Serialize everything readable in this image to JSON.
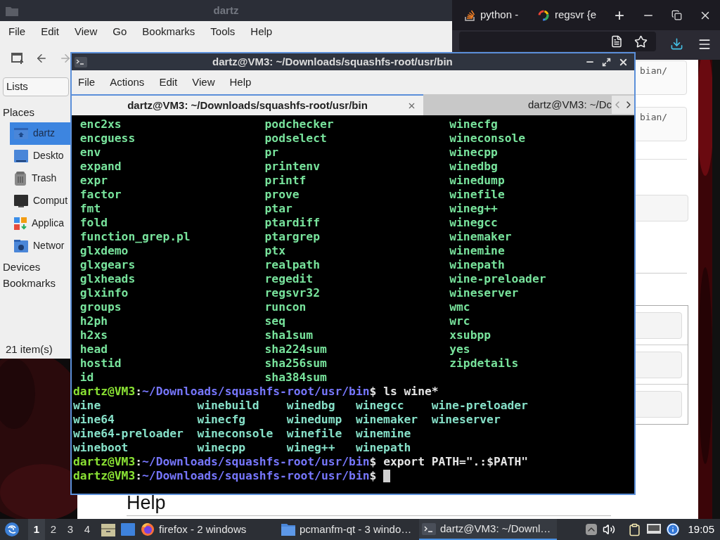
{
  "file_manager": {
    "title": "dartz",
    "menu": [
      "File",
      "Edit",
      "View",
      "Go",
      "Bookmarks",
      "Tools",
      "Help"
    ],
    "view_selector": "Lists",
    "places_heading": "Places",
    "places": [
      {
        "label": "dartz",
        "kind": "home",
        "selected": true
      },
      {
        "label": "Deskto",
        "kind": "desktop",
        "selected": false
      },
      {
        "label": "Trash",
        "kind": "trash",
        "selected": false
      },
      {
        "label": "Comput",
        "kind": "computer",
        "selected": false
      },
      {
        "label": "Applica",
        "kind": "apps",
        "selected": false
      },
      {
        "label": "Networ",
        "kind": "network",
        "selected": false
      }
    ],
    "sections": [
      "Devices",
      "Bookmarks"
    ],
    "status": "21 item(s)"
  },
  "browser": {
    "tabs": [
      {
        "label": "python -",
        "kind": "stack"
      },
      {
        "label": "regsvr {e",
        "kind": "google"
      }
    ],
    "new_tab": "+",
    "snippets": [
      "bian/",
      "bian/"
    ],
    "heading": "Help"
  },
  "terminal": {
    "title": "dartz@VM3: ~/Downloads/squashfs-root/usr/bin",
    "menu": [
      "File",
      "Actions",
      "Edit",
      "View",
      "Help"
    ],
    "tabs": [
      {
        "label": "dartz@VM3: ~/Downloads/squashfs-root/usr/bin",
        "selected": true
      },
      {
        "label": "dartz@VM3: ~/Dc",
        "selected": false
      }
    ],
    "output": [
      {
        "kind": "wide_listing",
        "columns": [
          [
            "enc2xs",
            "encguess",
            "env",
            "expand",
            "expr",
            "factor",
            "fmt",
            "fold",
            "function_grep.pl",
            "glxdemo",
            "glxgears",
            "glxheads",
            "glxinfo",
            "groups",
            "h2ph",
            "h2xs",
            "head",
            "hostid",
            "id"
          ],
          [
            "podchecker",
            "podselect",
            "pr",
            "printenv",
            "printf",
            "prove",
            "ptar",
            "ptardiff",
            "ptargrep",
            "ptx",
            "realpath",
            "regedit",
            "regsvr32",
            "runcon",
            "seq",
            "sha1sum",
            "sha224sum",
            "sha256sum",
            "sha384sum"
          ],
          [
            "winecfg",
            "wineconsole",
            "winecpp",
            "winedbg",
            "winedump",
            "winefile",
            "wineg++",
            "winegcc",
            "winemaker",
            "winemine",
            "winepath",
            "wine-preloader",
            "wineserver",
            "wmc",
            "wrc",
            "xsubpp",
            "yes",
            "zipdetails"
          ]
        ]
      },
      {
        "kind": "prompt",
        "cursor": false,
        "parts": [
          {
            "text": "dartz@VM3",
            "kind": "user"
          },
          {
            "text": ":",
            "kind": "plain"
          },
          {
            "text": "~/Downloads/squashfs-root/usr/bin",
            "kind": "path"
          },
          {
            "text": "$ ls wine*",
            "kind": "plain"
          }
        ]
      },
      {
        "kind": "listing",
        "columns": [
          [
            "wine",
            "wine64",
            "wine64-preloader",
            "wineboot"
          ],
          [
            "winebuild",
            "winecfg",
            "wineconsole",
            "winecpp"
          ],
          [
            "winedbg",
            "winedump",
            "winefile",
            "wineg++"
          ],
          [
            "winegcc",
            "winemaker",
            "winemine",
            "winepath"
          ],
          [
            "wine-preloader",
            "wineserver"
          ]
        ]
      },
      {
        "kind": "prompt",
        "cursor": false,
        "parts": [
          {
            "text": "dartz@VM3",
            "kind": "user"
          },
          {
            "text": ":",
            "kind": "plain"
          },
          {
            "text": "~/Downloads/squashfs-root/usr/bin",
            "kind": "path"
          },
          {
            "text": "$ export PATH=\".:$PATH\"",
            "kind": "plain"
          }
        ]
      },
      {
        "kind": "prompt",
        "cursor": true,
        "parts": [
          {
            "text": "dartz@VM3",
            "kind": "user"
          },
          {
            "text": ":",
            "kind": "plain"
          },
          {
            "text": "~/Downloads/squashfs-root/usr/bin",
            "kind": "path"
          },
          {
            "text": "$ ",
            "kind": "plain"
          }
        ]
      }
    ]
  },
  "taskbar": {
    "workspaces": [
      {
        "label": "1",
        "selected": true
      },
      {
        "label": "2",
        "selected": false
      },
      {
        "label": "3",
        "selected": false
      },
      {
        "label": "4",
        "selected": false
      }
    ],
    "tasks": [
      {
        "label": "firefox - 2 windows",
        "kind": "firefox",
        "selected": false
      },
      {
        "label": "pcmanfm-qt - 3 windo…",
        "kind": "folder",
        "selected": false
      },
      {
        "label": "dartz@VM3: ~/Downl…",
        "kind": "terminal",
        "selected": true
      }
    ],
    "clock": "19:05"
  }
}
